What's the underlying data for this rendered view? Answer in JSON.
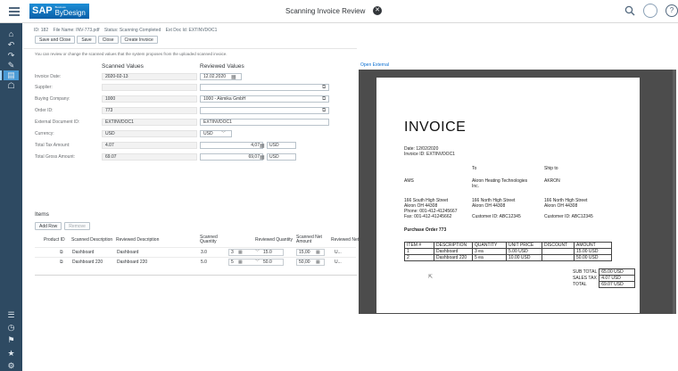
{
  "shell": {
    "logo_main": "SAP",
    "logo_super": "Business",
    "logo_sub": "ByDesign",
    "app_title": "Scanning Invoice Review",
    "close_glyph": "✕",
    "help_glyph": "?"
  },
  "rail": {
    "icons": [
      "home-icon",
      "undo-icon",
      "redo-icon",
      "tools-icon",
      "invoice-icon",
      "people-icon",
      "list-icon",
      "clock-icon",
      "flag-icon",
      "star-icon",
      "settings-icon"
    ],
    "glyphs": [
      "⌂",
      "↶",
      "↷",
      "✎",
      "▤",
      "☖",
      "☰",
      "◷",
      "⚑",
      "★",
      "⚙"
    ]
  },
  "header": {
    "id_text": "ID: 182",
    "file_text": "File Name: INV-773.pdf",
    "status_text": "Status: Scanning Completed",
    "ext_text": "Ext Doc Id: EXTINVDOC1"
  },
  "toolbar": {
    "save_close": "Save and Close",
    "save": "Save",
    "close": "Close",
    "create_invoice": "Create Invoice"
  },
  "info_text": "You can review or change the scanned values that the system proposes from the uploaded scanned invoice.",
  "columns": {
    "scanned": "Scanned Values",
    "reviewed": "Reviewed Values"
  },
  "fields": {
    "invoice_date": {
      "label": "Invoice Date:",
      "scanned": "2020-02-13",
      "reviewed": "12.02.2020"
    },
    "supplier": {
      "label": "Supplier:",
      "scanned": "",
      "reviewed": ""
    },
    "buying_company": {
      "label": "Buying Company:",
      "scanned": "1000",
      "reviewed": "1000 - Akmika GmbH"
    },
    "order_id": {
      "label": "Order ID:",
      "scanned": "773",
      "reviewed": ""
    },
    "ext_doc_id": {
      "label": "External Document ID:",
      "scanned": "EXTINVDOC1",
      "reviewed": "EXTINVDOC1"
    },
    "currency": {
      "label": "Currency:",
      "scanned": "USD",
      "reviewed": "USD"
    },
    "total_tax": {
      "label": "Total Tax Amount:",
      "scanned": "4.07",
      "reviewed": "4,07",
      "unit": "USD"
    },
    "total_gross": {
      "label": "Total Gross Amount:",
      "scanned": "69.07",
      "reviewed": "69,07",
      "unit": "USD"
    }
  },
  "items": {
    "title": "Items",
    "add_row": "Add Row",
    "remove": "Remove",
    "headers": {
      "product_id": "Product ID",
      "scanned_desc": "Scanned Description",
      "reviewed_desc": "Reviewed Description",
      "scanned_qty": "Scanned Quantity",
      "reviewed_qty": "Reviewed Quantity",
      "scanned_net": "Scanned Net Amount",
      "reviewed_net": "Reviewed Net Amount"
    },
    "rows": [
      {
        "scanned_desc": "Dashboard",
        "reviewed_desc": "Dashboard",
        "scanned_qty": "3.0",
        "reviewed_qty": "3",
        "scanned_net": "15.0",
        "reviewed_net": "15,00",
        "unit": "U..."
      },
      {
        "scanned_desc": "Dashboard 220",
        "reviewed_desc": "Dashboard 220",
        "scanned_qty": "5.0",
        "reviewed_qty": "5",
        "scanned_net": "50.0",
        "reviewed_net": "50,00",
        "unit": "U..."
      }
    ]
  },
  "pdf": {
    "open_external": "Open External",
    "title": "INVOICE",
    "date_line": "Date: 12/02/2020",
    "id_line": "Invoice ID: EXTINVDOC1",
    "to": "To",
    "ship_to": "Ship to",
    "from_name": "AMS",
    "to_name_1": "Akron Heating Technologies",
    "to_name_2": "Inc.",
    "ship_name": "AKRON",
    "from_addr_1": "166 South High Street",
    "from_addr_2": "Akron OH 44308",
    "from_addr_3": "Phone: 001-412-41245667",
    "from_addr_4": "Fax: 001-412-41245662",
    "to_addr_1": "166 North High Street",
    "to_addr_2": "Akron OH 44308",
    "to_cust": "Customer ID: ABC12345",
    "ship_addr_1": "166 North High Street",
    "ship_addr_2": "Akron OH 44308",
    "ship_cust": "Customer ID: ABC12345",
    "po": "Purchase Order 773",
    "table_head": [
      "ITEM #",
      "DESCRIPTION",
      "QUANTITY",
      "UNIT PRICE",
      "DISCOUNT",
      "AMOUNT"
    ],
    "table_rows": [
      [
        "1",
        "Dashboard",
        "3 ea",
        "5.00 USD",
        "",
        "15.00 USD"
      ],
      [
        "2",
        "Dashboard 220",
        "5 ea",
        "10.00 USD",
        "",
        "50.00 USD"
      ]
    ],
    "subtotal_label": "SUB TOTAL",
    "subtotal": "65.00 USD",
    "tax_label": "SALES TAX",
    "tax": "4.07 USD",
    "total_label": "TOTAL",
    "total": "69.07 USD"
  }
}
